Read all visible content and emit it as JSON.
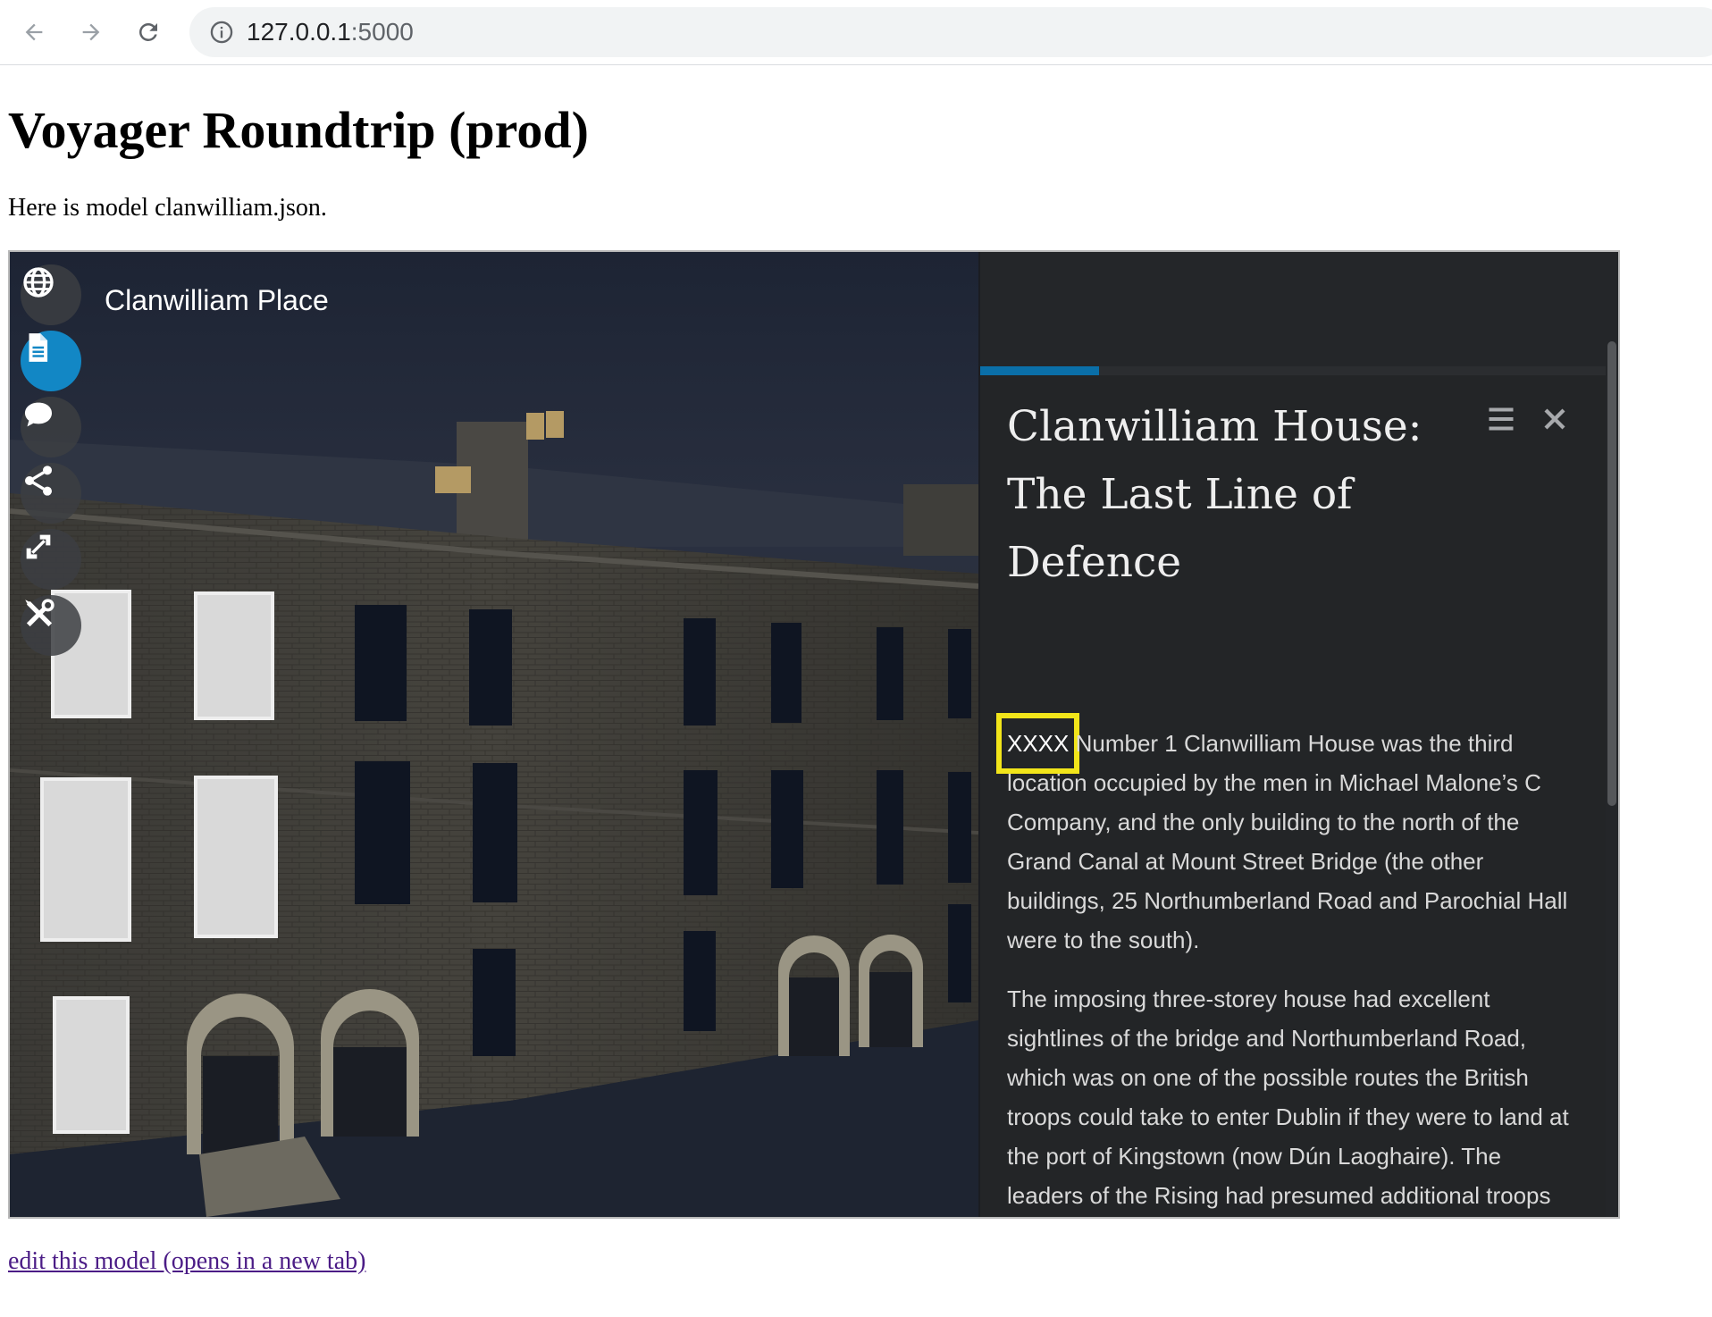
{
  "browser": {
    "back_icon": "arrow-left-icon",
    "forward_icon": "arrow-right-icon",
    "reload_icon": "reload-icon",
    "url_host": "127.0.0.1",
    "url_port": ":5000"
  },
  "page": {
    "title": "Voyager Roundtrip (prod)",
    "intro": "Here is model clanwilliam.json.",
    "edit_link": "edit this model (opens in a new tab)"
  },
  "viewer": {
    "scene_title": "Clanwilliam Place",
    "sidebar": [
      {
        "name": "globe-icon",
        "active": false
      },
      {
        "name": "document-icon",
        "active": true
      },
      {
        "name": "comment-icon",
        "active": false
      },
      {
        "name": "share-icon",
        "active": false
      },
      {
        "name": "fullscreen-icon",
        "active": false
      },
      {
        "name": "tools-icon",
        "active": false
      }
    ],
    "progress_fraction": 0.19,
    "article": {
      "title": "Clanwilliam House: The Last Line of Defence",
      "highlight": "XXXX",
      "p1_rest": "Number 1 Clanwilliam House was the third location occupied by the men in Michael Malone’s C Company, and the only building to the north of the Grand Canal at Mount Street Bridge (the other buildings, 25 Northumberland Road and Parochial Hall were to the south).",
      "p2": "The imposing three-storey house had excellent sightlines of the bridge and Northumberland Road, which was on one of the possible routes the British troops could take to enter Dublin if they were to land at the port of Kingstown (now Dún Laoghaire). The leaders of the Rising had presumed additional troops would be sent as reinforcements to the British garrison stationed in Ireland (which was training troops for the various theatres of the Great"
    },
    "colors": {
      "active_button": "#1287c5",
      "highlight_box": "#f2e51a",
      "progress": "#0a6fa8"
    }
  }
}
